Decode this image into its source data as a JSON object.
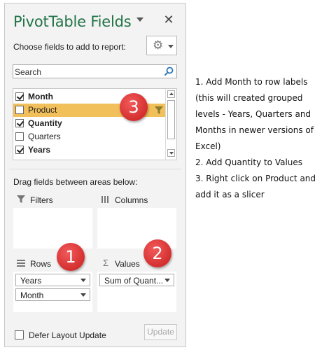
{
  "pane": {
    "title": "PivotTable Fields",
    "choose_label": "Choose fields to add to report:",
    "search_placeholder": "Search",
    "fields": [
      {
        "label": "Month",
        "checked": true,
        "bold": true
      },
      {
        "label": "Product",
        "checked": false,
        "bold": false,
        "highlighted": true
      },
      {
        "label": "Quantity",
        "checked": true,
        "bold": true
      },
      {
        "label": "Quarters",
        "checked": false,
        "bold": false
      },
      {
        "label": "Years",
        "checked": true,
        "bold": true
      }
    ],
    "drag_label": "Drag fields between areas below:",
    "areas": {
      "filters": {
        "label": "Filters",
        "icon": "funnel-icon"
      },
      "columns": {
        "label": "Columns",
        "icon": "columns-icon"
      },
      "rows": {
        "label": "Rows",
        "icon": "rows-icon",
        "items": [
          "Years",
          "Month"
        ]
      },
      "values": {
        "label": "Values",
        "icon": "sigma-icon",
        "items": [
          "Sum of Quant..."
        ]
      }
    },
    "defer_label": "Defer Layout Update",
    "update_label": "Update"
  },
  "badges": {
    "one": "1",
    "two": "2",
    "three": "3"
  },
  "notes": [
    "1. Add Month to row labels (this will created grouped levels - Years, Quarters and Months in newer versions of Excel)",
    "2. Add Quantity to Values",
    "3. Right click on Product and add it as a slicer"
  ],
  "colors": {
    "title_green": "#217346",
    "highlight": "#f2c05a",
    "badge_red": "#d42f2f"
  }
}
